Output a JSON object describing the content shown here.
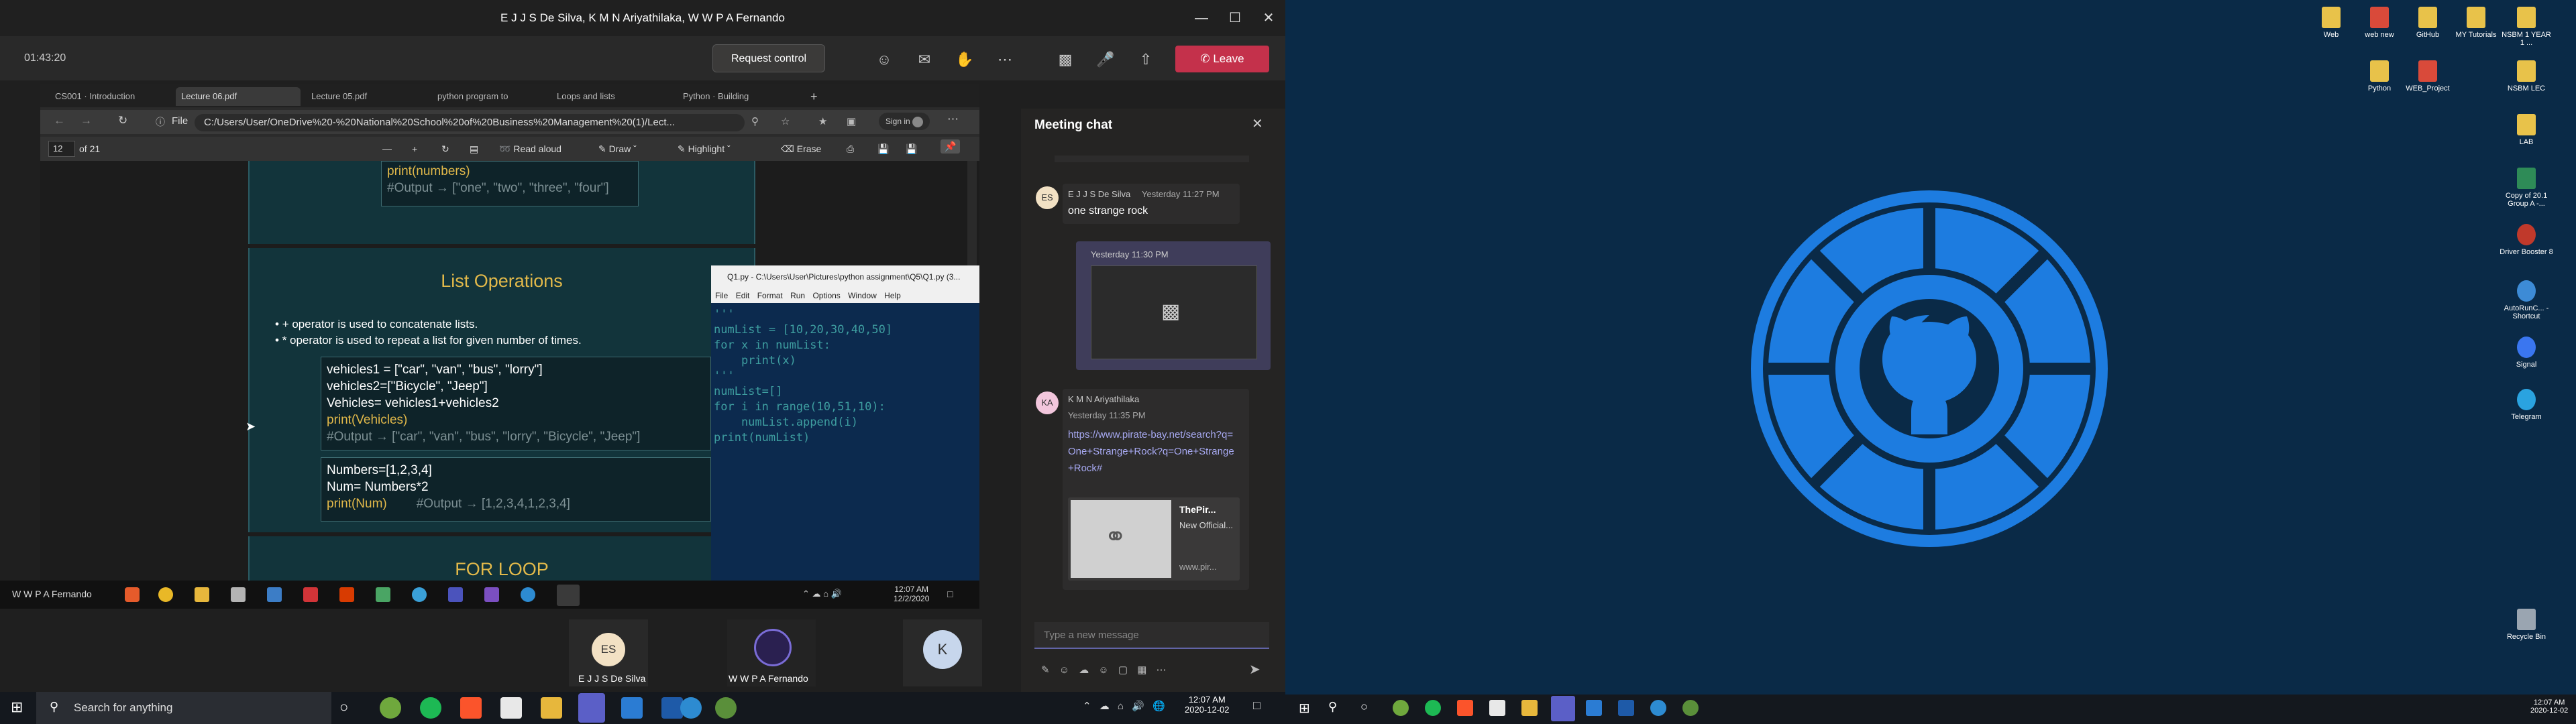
{
  "teams": {
    "title": "E J J S De Silva, K M N Ariyathilaka, W W P A Fernando",
    "timer": "01:43:20",
    "request_control": "Request control",
    "leave": "Leave",
    "presenter_tag": "W W P A Fernando"
  },
  "browser": {
    "tabs": [
      "CS001 · Introduction",
      "Lecture 06.pdf",
      "Lecture 05.pdf",
      "python program to",
      "Loops and lists",
      "Python · Building"
    ],
    "file_label": "File",
    "url": "C:/Users/User/OneDrive%20-%20National%20School%20of%20Business%20Management%20(1)/Lect...",
    "signin": "Sign in",
    "page_num": "12",
    "page_total": "of 21",
    "read_aloud": "Read aloud",
    "draw": "Draw",
    "highlight": "Highlight",
    "erase": "Erase"
  },
  "slide": {
    "top_code_line1": "print(numbers)",
    "top_code_line2": "#Output → [\"one\", \"two\", \"three\", \"four\"]",
    "heading": "List Operations",
    "bullet1": "+ operator is used to concatenate lists.",
    "bullet2": "* operator is used to repeat a list for given number of times.",
    "code1": [
      "vehicles1 = [\"car\", \"van\", \"bus\", \"lorry\"]",
      "vehicles2=[\"Bicycle\", \"Jeep\"]",
      "Vehicles= vehicles1+vehicles2",
      "print(Vehicles)",
      "#Output → [\"car\", \"van\", \"bus\", \"lorry\", \"Bicycle\", \"Jeep\"]"
    ],
    "code2_l1": "Numbers=[1,2,3,4]",
    "code2_l2": "Num= Numbers*2",
    "code2_l3a": "print(Num)",
    "code2_l3b": "#Output → [1,2,3,4,1,2,3,4]",
    "next_heading": "FOR LOOP"
  },
  "idle": {
    "title": "Q1.py - C:\\Users\\User\\Pictures\\python assignment\\Q5\\Q1.py (3...",
    "menu": [
      "File",
      "Edit",
      "Format",
      "Run",
      "Options",
      "Window",
      "Help"
    ],
    "code": "'''\nnumList = [10,20,30,40,50]\nfor x in numList:\n    print(x)\n'''\nnumList=[]\nfor i in range(10,51,10):\n    numList.append(i)\nprint(numList)"
  },
  "remote_taskbar": {
    "time": "12:07 AM",
    "date": "12/2/2020"
  },
  "chat": {
    "title": "Meeting chat",
    "m1_author": "E J J S De Silva",
    "m1_time": "Yesterday 11:27 PM",
    "m1_text": "one strange rock",
    "m2_time": "Yesterday 11:30 PM",
    "m3_author": "K M N Ariyathilaka",
    "m3_time": "Yesterday 11:35 PM",
    "m3_link": "https://www.pirate-bay.net/search?q=One+Strange+Rock?q=One+Strange+Rock#",
    "card_title": "ThePir...",
    "card_sub": "New Official...",
    "card_url": "www.pir...",
    "compose": "Type a new message",
    "es_initials": "ES",
    "ka_initials": "KA"
  },
  "participants": [
    {
      "initials": "ES",
      "name": "E J J S De Silva"
    },
    {
      "initials": "",
      "name": "W W P A Fernando"
    },
    {
      "initials": "K",
      "name": ""
    }
  ],
  "taskbar": {
    "search": "Search for anything",
    "time": "12:07 AM",
    "date": "2020-12-02",
    "time2": "12:07 AM",
    "date2": "2020-12-02"
  },
  "desktop_icons": [
    {
      "label": "Web",
      "color": "#e8c24a"
    },
    {
      "label": "web new",
      "color": "#d94a3a"
    },
    {
      "label": "GitHub",
      "color": "#e8c24a"
    },
    {
      "label": "MY Tutorials",
      "color": "#e8c24a"
    },
    {
      "label": "NSBM 1 YEAR 1 ...",
      "color": "#e8c24a"
    },
    {
      "label": "Python",
      "color": "#e8c24a"
    },
    {
      "label": "WEB_Project",
      "color": "#d94a3a"
    },
    {
      "label": "NSBM LEC",
      "color": "#e8c24a"
    },
    {
      "label": "LAB",
      "color": "#e8c24a"
    },
    {
      "label": "Copy of 20.1 Group A -...",
      "color": "#2e8b57"
    },
    {
      "label": "Driver Booster 8",
      "color": "#c0392b"
    },
    {
      "label": "AutoRunC... - Shortcut",
      "color": "#3d8bd6"
    },
    {
      "label": "Signal",
      "color": "#3a76f0"
    },
    {
      "label": "Telegram",
      "color": "#2aa3e0"
    },
    {
      "label": "Recycle Bin",
      "color": "#9aa5b1"
    }
  ]
}
